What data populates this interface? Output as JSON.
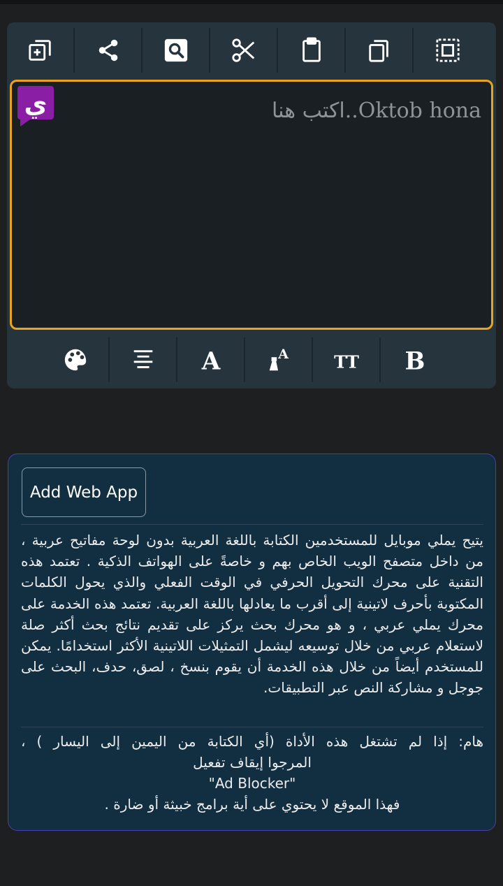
{
  "editor": {
    "placeholder": "Oktob hona..اكتب هنا",
    "logo_glyph": "ي",
    "top_toolbar": [
      {
        "icon": "add-copy-icon"
      },
      {
        "icon": "share-icon"
      },
      {
        "icon": "search-icon"
      },
      {
        "icon": "cut-icon"
      },
      {
        "icon": "clipboard-icon"
      },
      {
        "icon": "copy-icon"
      },
      {
        "icon": "select-all-icon"
      }
    ],
    "bottom_toolbar": [
      {
        "icon": "palette-icon"
      },
      {
        "icon": "align-center-icon"
      },
      {
        "icon": "font-icon",
        "glyph": "A"
      },
      {
        "icon": "font-color-icon",
        "glyph": "A"
      },
      {
        "icon": "text-size-icon",
        "glyph": "TT"
      },
      {
        "icon": "bold-icon",
        "glyph": "B"
      }
    ]
  },
  "info": {
    "add_web_app_label": "Add Web App",
    "description": "يتيح يملي موبايل للمستخدمين الكتابة باللغة العربية بدون لوحة مفاتيح عربية ، من داخل متصفح الويب الخاص بهم و خاصةً على الهواتف الذكية . تعتمد هذه التقنية على محرك التحويل الحرفي في الوقت الفعلي والذي يحول الكلمات المكتوبة بأحرف لاتينية إلى أقرب ما يعادلها باللغة العربية. تعتمد هذه الخدمة على محرك يملي عربي ، و هو محرك بحث يركز على تقديم نتائج بحث أكثر صلة لاستعلام عربي من خلال توسيعه ليشمل التمثيلات اللاتينية الأكثر استخدامًا. يمكن للمستخدم أيضاً من خلال هذه الخدمة أن يقوم بنسخ ، لصق، حدف، البحث على جوجل و مشاركة النص عبر التطبيقات.",
    "note_line1": "هام: إذا لم تشتغل هذه الأداة (أي الكتابة من اليمين إلى اليسار ) ،",
    "note_line2": "المرجوا إيقاف تفعيل",
    "note_line3": "\"Ad Blocker\"",
    "note_line4": "فهذا الموقع لا يحتوي على أية برامج خبيثة أو ضارة ."
  },
  "colors": {
    "card_bg": "#26343e",
    "accent_border": "#e8a31f",
    "logo_purple": "#8a1fa6",
    "info_bg": "#122f42",
    "info_border": "#4a3fae"
  }
}
